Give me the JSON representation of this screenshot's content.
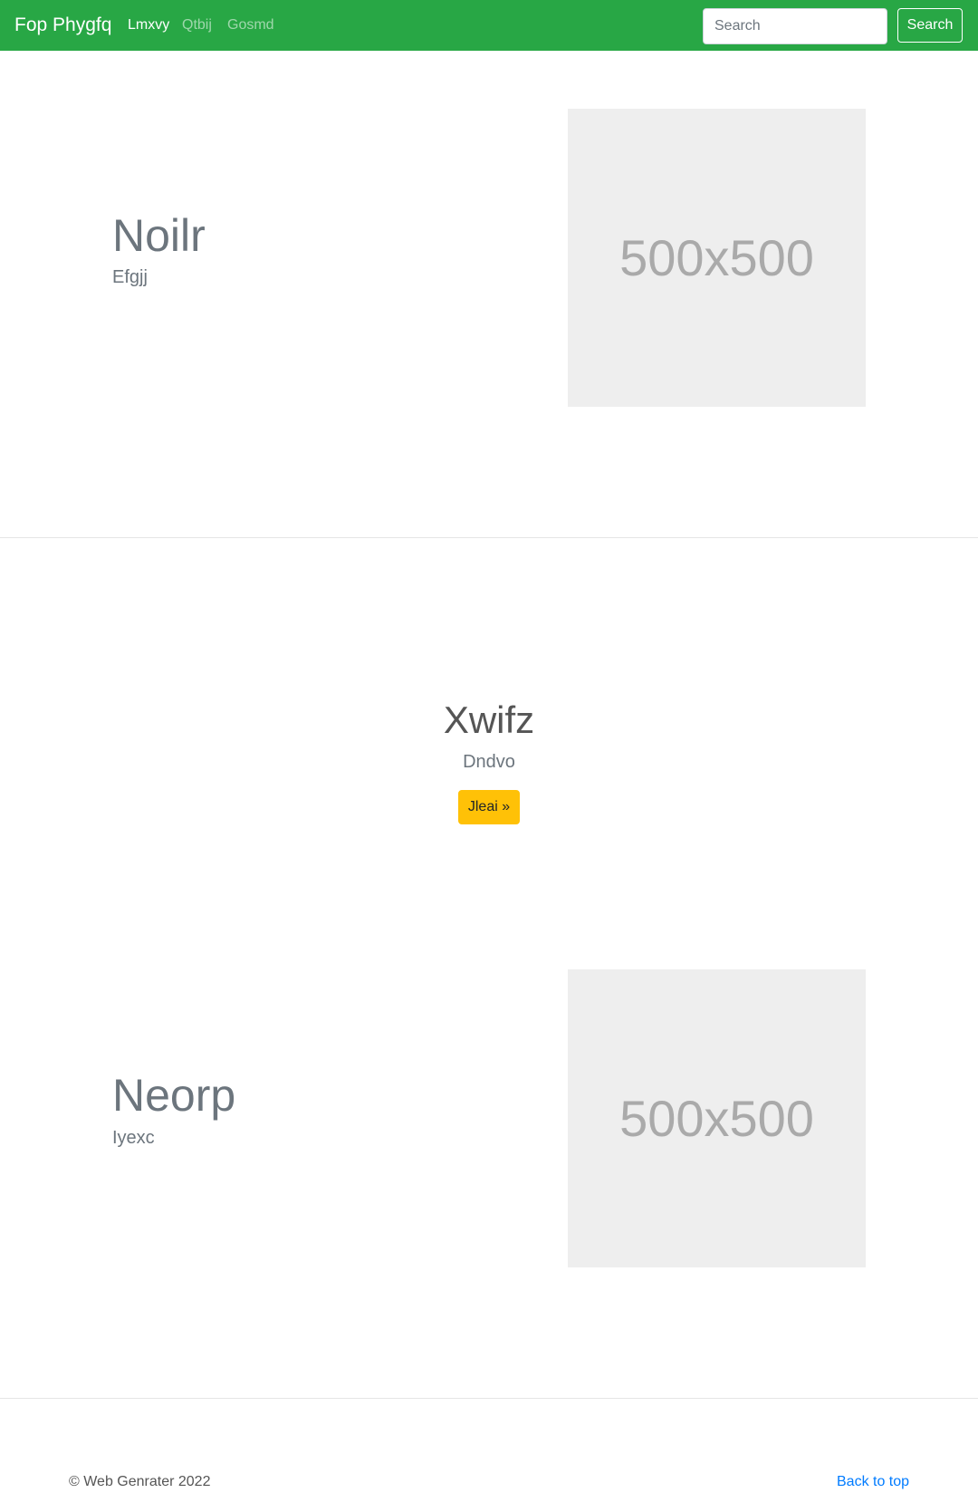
{
  "navbar": {
    "brand": "Fop Phygfq",
    "links": [
      {
        "label": "Lmxvy",
        "active": true
      },
      {
        "label": "Qtbij",
        "active": false
      },
      {
        "label": "Gosmd",
        "active": false
      }
    ],
    "search_placeholder": "Search",
    "search_button": "Search",
    "color": "#28a745"
  },
  "features": [
    {
      "title": "Noilr",
      "subtitle": "Efgjj",
      "image_label": "500x500"
    },
    {
      "title": "Neorp",
      "subtitle": "Iyexc",
      "image_label": "500x500"
    }
  ],
  "center": {
    "title": "Xwifz",
    "subtitle": "Dndvo",
    "button_label": "Jleai »",
    "button_color": "#ffc107"
  },
  "footer": {
    "copyright": "© Web Genrater 2022",
    "back_to_top": "Back to top"
  }
}
